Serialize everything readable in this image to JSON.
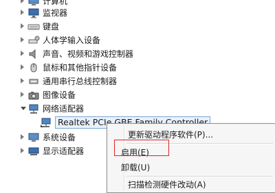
{
  "tree": {
    "items": [
      {
        "label": "计算机",
        "icon": "computer-icon"
      },
      {
        "label": "监视器",
        "icon": "monitor-icon"
      },
      {
        "label": "键盘",
        "icon": "keyboard-icon"
      },
      {
        "label": "人体学输入设备",
        "icon": "hid-icon"
      },
      {
        "label": "声音、视频和游戏控制器",
        "icon": "speaker-icon"
      },
      {
        "label": "鼠标和其他指针设备",
        "icon": "mouse-icon"
      },
      {
        "label": "通用串行总线控制器",
        "icon": "usb-icon"
      },
      {
        "label": "图像设备",
        "icon": "camera-icon"
      },
      {
        "label": "网络适配器",
        "icon": "network-icon",
        "expanded": true
      },
      {
        "label": "Realtek PCIe GBE Family Controller",
        "icon": "network-card-icon",
        "child": true
      },
      {
        "label": "系统设备",
        "icon": "system-icon"
      },
      {
        "label": "显示适配器",
        "icon": "display-adapter-icon"
      }
    ]
  },
  "context_menu": {
    "items": [
      {
        "label": "更新驱动程序软件(P)..."
      },
      {
        "label": "启用(E)"
      },
      {
        "label": "卸载(U)"
      },
      {
        "label": "扫描检测硬件改动(A)"
      }
    ]
  }
}
